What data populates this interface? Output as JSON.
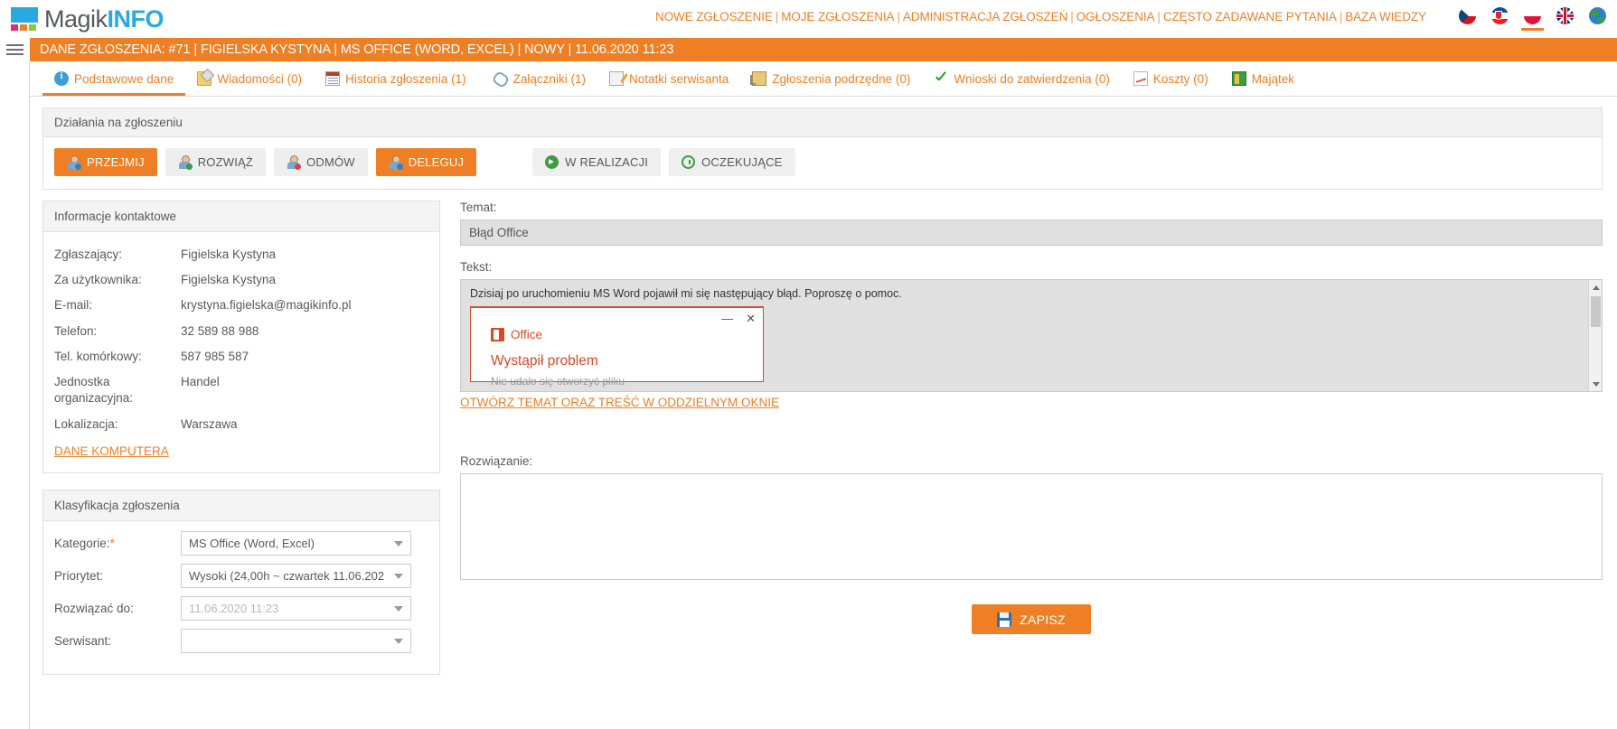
{
  "brand": {
    "magik": "Magik",
    "info": "INFO"
  },
  "topnav": {
    "items": [
      "NOWE ZGŁOSZENIE",
      "MOJE ZGŁOSZENIA",
      "ADMINISTRACJA ZGŁOSZEŃ",
      "OGŁOSZENIA",
      "CZĘSTO ZADAWANE PYTANIA",
      "BAZA WIEDZY"
    ],
    "separator": "|"
  },
  "languages": [
    {
      "name": "flag-czech-icon",
      "selected": false
    },
    {
      "name": "flag-slovak-icon",
      "selected": false
    },
    {
      "name": "flag-poland-icon",
      "selected": true
    },
    {
      "name": "flag-uk-icon",
      "selected": false
    },
    {
      "name": "globe-icon",
      "selected": false
    }
  ],
  "titlebar": {
    "text": "DANE ZGŁOSZENIA: #71 | FIGIELSKA KYSTYNA | MS OFFICE (WORD, EXCEL) | NOWY | 11.06.2020 11:23"
  },
  "tabs": [
    {
      "label": "Podstawowe dane",
      "icon": "info-icon",
      "active": true
    },
    {
      "label": "Wiadomości (0)",
      "icon": "message-icon",
      "active": false
    },
    {
      "label": "Historia zgłoszenia (1)",
      "icon": "calendar-icon",
      "active": false
    },
    {
      "label": "Załączniki (1)",
      "icon": "paperclip-icon",
      "active": false
    },
    {
      "label": "Notatki serwisanta",
      "icon": "note-pencil-icon",
      "active": false
    },
    {
      "label": "Zgłoszenia podrzędne (0)",
      "icon": "subtickets-icon",
      "active": false
    },
    {
      "label": "Wnioski do zatwierdzenia (0)",
      "icon": "check-icon",
      "active": false
    },
    {
      "label": "Koszty (0)",
      "icon": "chart-icon",
      "active": false
    },
    {
      "label": "Majątek",
      "icon": "asset-icon",
      "active": false
    }
  ],
  "actions": {
    "title": "Działania na zgłoszeniu",
    "buttons": [
      {
        "label": "PRZEJMIJ",
        "style": "primary",
        "icon": "person-take-icon"
      },
      {
        "label": "ROZWIĄŻ",
        "style": "plain",
        "icon": "person-solve-icon"
      },
      {
        "label": "ODMÓW",
        "style": "plain",
        "icon": "person-refuse-icon"
      },
      {
        "label": "DELEGUJ",
        "style": "primary",
        "icon": "person-delegate-icon"
      },
      {
        "label": "W REALIZACJI",
        "style": "plain2",
        "icon": "play-icon"
      },
      {
        "label": "OCZEKUJĄCE",
        "style": "plain2",
        "icon": "clock-icon"
      }
    ]
  },
  "contact": {
    "title": "Informacje kontaktowe",
    "rows": [
      {
        "label": "Zgłaszający:",
        "value": "Figielska Kystyna"
      },
      {
        "label": "Za użytkownika:",
        "value": "Figielska Kystyna"
      },
      {
        "label": "E-mail:",
        "value": "krystyna.figielska@magikinfo.pl"
      },
      {
        "label": "Telefon:",
        "value": "32 589 88 988"
      },
      {
        "label": "Tel. komórkowy:",
        "value": "587 985 587"
      },
      {
        "label": "Jednostka organizacyjna:",
        "value": "Handel"
      },
      {
        "label": "Lokalizacja:",
        "value": "Warszawa"
      }
    ],
    "link": "DANE KOMPUTERA"
  },
  "classification": {
    "title": "Klasyfikacja zgłoszenia",
    "fields": [
      {
        "label": "Kategorie:",
        "required": true,
        "value": "MS Office (Word, Excel)",
        "disabled": false
      },
      {
        "label": "Priorytet:",
        "required": false,
        "value": "Wysoki (24,00h ~ czwartek 11.06.202",
        "disabled": false
      },
      {
        "label": "Rozwiązać do:",
        "required": false,
        "value": "11.06.2020 11:23",
        "disabled": true
      },
      {
        "label": "Serwisant:",
        "required": false,
        "value": "",
        "disabled": false
      }
    ]
  },
  "ticket": {
    "subject_label": "Temat:",
    "subject_value": "Błąd Office",
    "text_label": "Tekst:",
    "text_value": "Dzisiaj po uruchomieniu MS Word pojawił mi się następujący błąd. Poproszę o pomoc.",
    "open_link": "OTWÓRZ TEMAT ORAZ TREŚĆ W ODDZIELNYM OKNIE",
    "embedded_dialog": {
      "brand": "Office",
      "heading": "Wystąpił problem",
      "subtext": "Nie udało się otworzyć pliku",
      "minimize": "—",
      "close": "✕"
    },
    "solution_label": "Rozwiązanie:",
    "solution_value": ""
  },
  "save": {
    "label": "ZAPISZ",
    "icon": "floppy-disk-icon"
  },
  "colors": {
    "accent": "#ee7f24",
    "brand_blue": "#2aa9e0",
    "text": "#58595b"
  }
}
